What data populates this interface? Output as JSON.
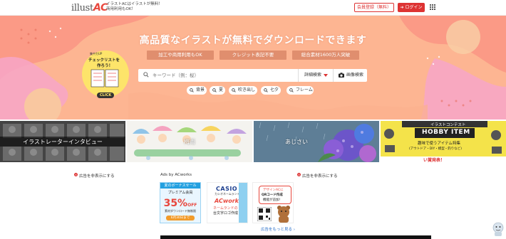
{
  "header": {
    "logo_text": "illust",
    "logo_accent": "AC",
    "tagline_1": "イラストACはイラストが無料！",
    "tagline_2": "商用利用もOK！",
    "register_label": "会員登録（無料）",
    "login_label": "ログイン",
    "login_icon": "login-arrow-icon",
    "apps_icon": "grid-icon"
  },
  "hero": {
    "title": "高品質なイラストが無料でダウンロードできます",
    "features": [
      "加工や商用利用もOK",
      "クレジット表記不要",
      "総合素材1600万人突破"
    ],
    "search": {
      "placeholder": "キーワード（例：桜）",
      "detail_label": "詳細検索",
      "image_search_label": "画像検索"
    },
    "tags": [
      "背景",
      "夏",
      "吹き出し",
      "七夕",
      "フレーム"
    ],
    "badge": {
      "top_text": "集中力UP",
      "main_line_1": "チェックリストを",
      "main_line_2": "作ろう！",
      "click_label": "CLICK"
    }
  },
  "panels": [
    {
      "label": "イラストレーターインタビュー"
    },
    {
      "label": "梅雨"
    },
    {
      "label": "あじさい"
    },
    {
      "label": "イラストコンテスト",
      "title": "HOBBY ITEM",
      "sub": "趣味で使うアイテム特集",
      "detail": "(アウトドア・DIY・模型・釣りなど)",
      "footer": "い賞発表！"
    }
  ],
  "ads": {
    "hide_label": "広告を非表示にする",
    "ads_by": "Ads by ACworks",
    "more_label": "広告をもっと見る",
    "items": [
      {
        "line1": "夏のボーナスセール",
        "line2": "プレミアム会員",
        "discount": "35%",
        "off": "OFF",
        "line3": "素材ダウンロード無制限",
        "date": "6月30日まで"
      },
      {
        "brand": "CASIO",
        "line1": "カシオネームランド",
        "logo": "ACworks",
        "line2": "ネームランドの",
        "line3": "台文字ロゴ作成"
      },
      {
        "line1": "デザインACに",
        "line2": "QRコード作成",
        "line3": "機能が追加！"
      }
    ]
  }
}
